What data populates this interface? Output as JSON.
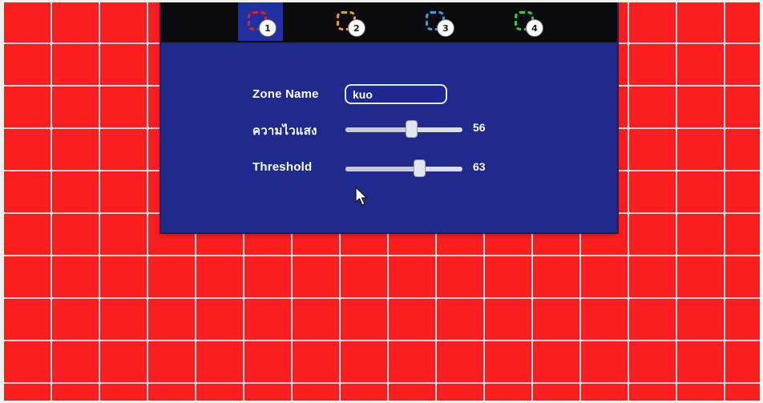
{
  "colors": {
    "background": "#fa1e1e",
    "grid_lines": "#e8e0f0",
    "panel": "#202a8c",
    "tab_bar": "#0b0b0e"
  },
  "tabs": [
    {
      "number": "1",
      "icon_color": "#e02020",
      "selected": true
    },
    {
      "number": "2",
      "icon_color": "#e0a030",
      "selected": false
    },
    {
      "number": "3",
      "icon_color": "#30a0f0",
      "selected": false
    },
    {
      "number": "4",
      "icon_color": "#30d030",
      "selected": false
    }
  ],
  "zone_name": {
    "label": "Zone Name",
    "value": "kuo"
  },
  "sensitivity": {
    "label": "ความไวแสง",
    "value": "56",
    "level": 0.56
  },
  "threshold": {
    "label": "Threshold",
    "value": "63",
    "level": 0.63
  }
}
